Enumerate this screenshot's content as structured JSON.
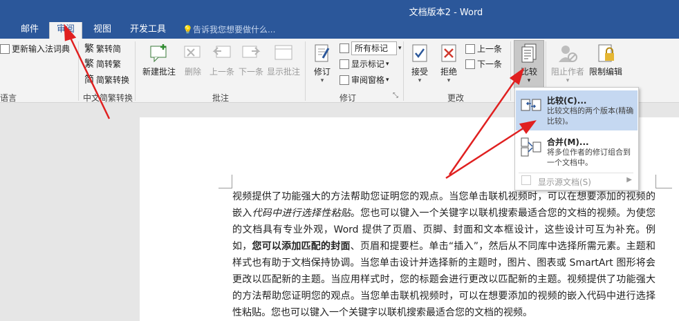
{
  "window": {
    "title": "文档版本2 - Word"
  },
  "tabs": [
    {
      "label": "邮件"
    },
    {
      "label": "审阅"
    },
    {
      "label": "视图"
    },
    {
      "label": "开发工具"
    }
  ],
  "tell_me": "告诉我您想要做什么...",
  "ribbon": {
    "language": {
      "update_ime": "更新输入法词典",
      "label": "语言"
    },
    "chinese_conv": {
      "trad_to_simp": "繁转简",
      "simp_to_trad": "简转繁",
      "convert": "简繁转换",
      "label": "中文简繁转换"
    },
    "comments": {
      "new": "新建批注",
      "delete": "删除",
      "prev": "上一条",
      "next": "下一条",
      "show": "显示批注",
      "label": "批注"
    },
    "tracking": {
      "track": "修订",
      "markup_select": "所有标记",
      "show_markup": "显示标记",
      "review_pane": "审阅窗格",
      "label": "修订"
    },
    "changes": {
      "accept": "接受",
      "reject": "拒绝",
      "prev": "上一条",
      "next": "下一条",
      "label": "更改"
    },
    "compare": {
      "compare": "比较"
    },
    "protect": {
      "block_authors": "阻止作者",
      "restrict": "限制编辑"
    }
  },
  "compare_menu": {
    "compare_title": "比较(C)...",
    "compare_desc": "比较文档的两个版本(精确比较)。",
    "combine_title": "合并(M)...",
    "combine_desc": "将多位作者的修订组合到一个文档中。",
    "show_source": "显示源文档(S)"
  },
  "document": {
    "p1": "视频提供了功能强大的方法帮助您证明您的观点。当您单击联机视频时，可以在想要添加的视频的嵌入",
    "p1_italic": "代码中进行选择性粘贴",
    "p2": "。您也可以键入一个关键字以联机搜索最适合您的文档的视频。为使您的文档具有专业外观，Word 提供了页眉、页脚、封面和文本框设计，这些设计可互为补充。例如，",
    "p2_bold": "您可以添加匹配的封面",
    "p3": "、页眉和提要栏。单击“插入”，然后从不同库中选择所需元素。主题和样式也有助于文档保持协调。当您单击设计并选择新的主题时，图片、图表或 SmartArt 图形将会更改以匹配新的主题。当应用样式时，您的标题会进行更改以匹配新的主题。视频提供了功能强大的方法帮助您证明您的观点。当您单击联机视频时，可以在想要添加的视频的嵌入代码中进行选择性粘贴。您也可以键入一个关键字以联机搜索最适合您的文档的视频。"
  }
}
